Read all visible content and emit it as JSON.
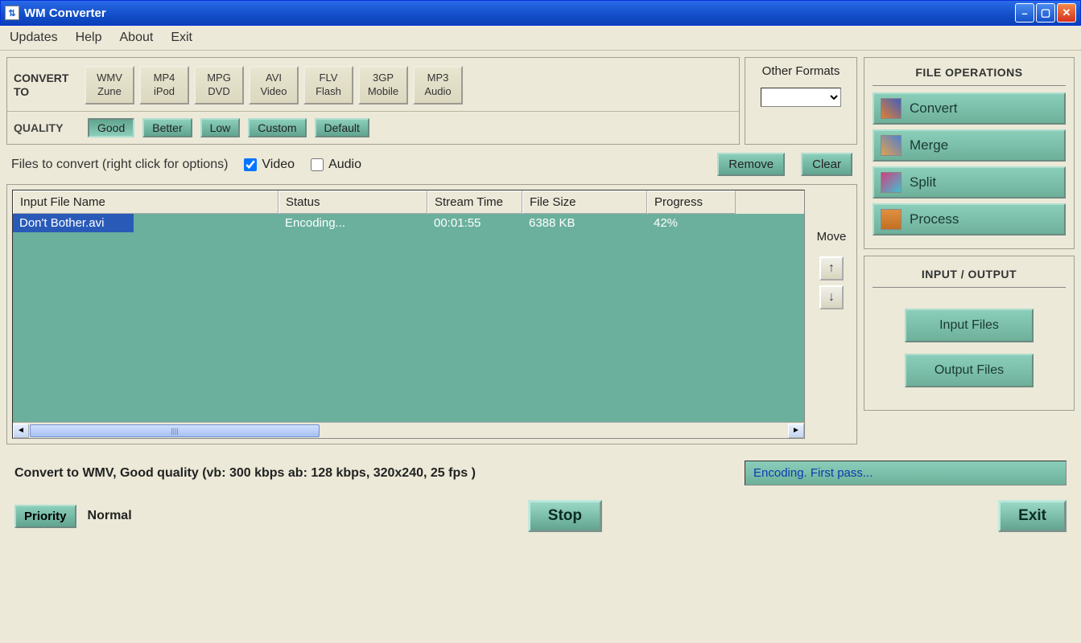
{
  "window": {
    "title": "WM Converter"
  },
  "menu": {
    "updates": "Updates",
    "help": "Help",
    "about": "About",
    "exit": "Exit"
  },
  "convert": {
    "label": "CONVERT TO",
    "formats": [
      {
        "line1": "WMV",
        "line2": "Zune"
      },
      {
        "line1": "MP4",
        "line2": "iPod"
      },
      {
        "line1": "MPG",
        "line2": "DVD"
      },
      {
        "line1": "AVI",
        "line2": "Video"
      },
      {
        "line1": "FLV",
        "line2": "Flash"
      },
      {
        "line1": "3GP",
        "line2": "Mobile"
      },
      {
        "line1": "MP3",
        "line2": "Audio"
      }
    ],
    "other_label": "Other Formats"
  },
  "quality": {
    "label": "QUALITY",
    "good": "Good",
    "better": "Better",
    "low": "Low",
    "custom": "Custom",
    "default": "Default"
  },
  "files": {
    "label": "Files to convert (right click for options)",
    "video": "Video",
    "audio": "Audio",
    "remove": "Remove",
    "clear": "Clear",
    "move": "Move",
    "columns": {
      "name": "Input File Name",
      "status": "Status",
      "stream": "Stream Time",
      "size": "File Size",
      "progress": "Progress"
    },
    "rows": [
      {
        "name": "Don't Bother.avi",
        "status": "Encoding...",
        "stream": "00:01:55",
        "size": "6388 KB",
        "progress": "42%"
      }
    ]
  },
  "ops": {
    "title": "FILE OPERATIONS",
    "convert": "Convert",
    "merge": "Merge",
    "split": "Split",
    "process": "Process"
  },
  "io": {
    "title": "INPUT / OUTPUT",
    "input": "Input Files",
    "output": "Output Files"
  },
  "status": {
    "summary": "Convert to WMV, Good quality (vb: 300 kbps ab: 128 kbps, 320x240, 25 fps )",
    "encoding": "Encoding. First pass..."
  },
  "bottom": {
    "priority": "Priority",
    "priority_val": "Normal",
    "stop": "Stop",
    "exit": "Exit"
  }
}
